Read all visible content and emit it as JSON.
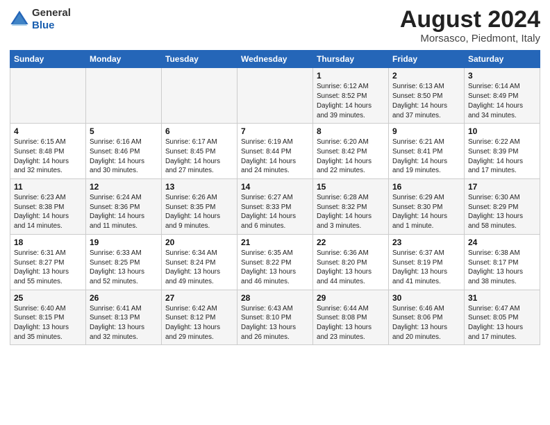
{
  "header": {
    "logo_general": "General",
    "logo_blue": "Blue",
    "month_year": "August 2024",
    "location": "Morsasco, Piedmont, Italy"
  },
  "weekdays": [
    "Sunday",
    "Monday",
    "Tuesday",
    "Wednesday",
    "Thursday",
    "Friday",
    "Saturday"
  ],
  "weeks": [
    [
      {
        "day": "",
        "info": ""
      },
      {
        "day": "",
        "info": ""
      },
      {
        "day": "",
        "info": ""
      },
      {
        "day": "",
        "info": ""
      },
      {
        "day": "1",
        "info": "Sunrise: 6:12 AM\nSunset: 8:52 PM\nDaylight: 14 hours\nand 39 minutes."
      },
      {
        "day": "2",
        "info": "Sunrise: 6:13 AM\nSunset: 8:50 PM\nDaylight: 14 hours\nand 37 minutes."
      },
      {
        "day": "3",
        "info": "Sunrise: 6:14 AM\nSunset: 8:49 PM\nDaylight: 14 hours\nand 34 minutes."
      }
    ],
    [
      {
        "day": "4",
        "info": "Sunrise: 6:15 AM\nSunset: 8:48 PM\nDaylight: 14 hours\nand 32 minutes."
      },
      {
        "day": "5",
        "info": "Sunrise: 6:16 AM\nSunset: 8:46 PM\nDaylight: 14 hours\nand 30 minutes."
      },
      {
        "day": "6",
        "info": "Sunrise: 6:17 AM\nSunset: 8:45 PM\nDaylight: 14 hours\nand 27 minutes."
      },
      {
        "day": "7",
        "info": "Sunrise: 6:19 AM\nSunset: 8:44 PM\nDaylight: 14 hours\nand 24 minutes."
      },
      {
        "day": "8",
        "info": "Sunrise: 6:20 AM\nSunset: 8:42 PM\nDaylight: 14 hours\nand 22 minutes."
      },
      {
        "day": "9",
        "info": "Sunrise: 6:21 AM\nSunset: 8:41 PM\nDaylight: 14 hours\nand 19 minutes."
      },
      {
        "day": "10",
        "info": "Sunrise: 6:22 AM\nSunset: 8:39 PM\nDaylight: 14 hours\nand 17 minutes."
      }
    ],
    [
      {
        "day": "11",
        "info": "Sunrise: 6:23 AM\nSunset: 8:38 PM\nDaylight: 14 hours\nand 14 minutes."
      },
      {
        "day": "12",
        "info": "Sunrise: 6:24 AM\nSunset: 8:36 PM\nDaylight: 14 hours\nand 11 minutes."
      },
      {
        "day": "13",
        "info": "Sunrise: 6:26 AM\nSunset: 8:35 PM\nDaylight: 14 hours\nand 9 minutes."
      },
      {
        "day": "14",
        "info": "Sunrise: 6:27 AM\nSunset: 8:33 PM\nDaylight: 14 hours\nand 6 minutes."
      },
      {
        "day": "15",
        "info": "Sunrise: 6:28 AM\nSunset: 8:32 PM\nDaylight: 14 hours\nand 3 minutes."
      },
      {
        "day": "16",
        "info": "Sunrise: 6:29 AM\nSunset: 8:30 PM\nDaylight: 14 hours\nand 1 minute."
      },
      {
        "day": "17",
        "info": "Sunrise: 6:30 AM\nSunset: 8:29 PM\nDaylight: 13 hours\nand 58 minutes."
      }
    ],
    [
      {
        "day": "18",
        "info": "Sunrise: 6:31 AM\nSunset: 8:27 PM\nDaylight: 13 hours\nand 55 minutes."
      },
      {
        "day": "19",
        "info": "Sunrise: 6:33 AM\nSunset: 8:25 PM\nDaylight: 13 hours\nand 52 minutes."
      },
      {
        "day": "20",
        "info": "Sunrise: 6:34 AM\nSunset: 8:24 PM\nDaylight: 13 hours\nand 49 minutes."
      },
      {
        "day": "21",
        "info": "Sunrise: 6:35 AM\nSunset: 8:22 PM\nDaylight: 13 hours\nand 46 minutes."
      },
      {
        "day": "22",
        "info": "Sunrise: 6:36 AM\nSunset: 8:20 PM\nDaylight: 13 hours\nand 44 minutes."
      },
      {
        "day": "23",
        "info": "Sunrise: 6:37 AM\nSunset: 8:19 PM\nDaylight: 13 hours\nand 41 minutes."
      },
      {
        "day": "24",
        "info": "Sunrise: 6:38 AM\nSunset: 8:17 PM\nDaylight: 13 hours\nand 38 minutes."
      }
    ],
    [
      {
        "day": "25",
        "info": "Sunrise: 6:40 AM\nSunset: 8:15 PM\nDaylight: 13 hours\nand 35 minutes."
      },
      {
        "day": "26",
        "info": "Sunrise: 6:41 AM\nSunset: 8:13 PM\nDaylight: 13 hours\nand 32 minutes."
      },
      {
        "day": "27",
        "info": "Sunrise: 6:42 AM\nSunset: 8:12 PM\nDaylight: 13 hours\nand 29 minutes."
      },
      {
        "day": "28",
        "info": "Sunrise: 6:43 AM\nSunset: 8:10 PM\nDaylight: 13 hours\nand 26 minutes."
      },
      {
        "day": "29",
        "info": "Sunrise: 6:44 AM\nSunset: 8:08 PM\nDaylight: 13 hours\nand 23 minutes."
      },
      {
        "day": "30",
        "info": "Sunrise: 6:46 AM\nSunset: 8:06 PM\nDaylight: 13 hours\nand 20 minutes."
      },
      {
        "day": "31",
        "info": "Sunrise: 6:47 AM\nSunset: 8:05 PM\nDaylight: 13 hours\nand 17 minutes."
      }
    ]
  ]
}
